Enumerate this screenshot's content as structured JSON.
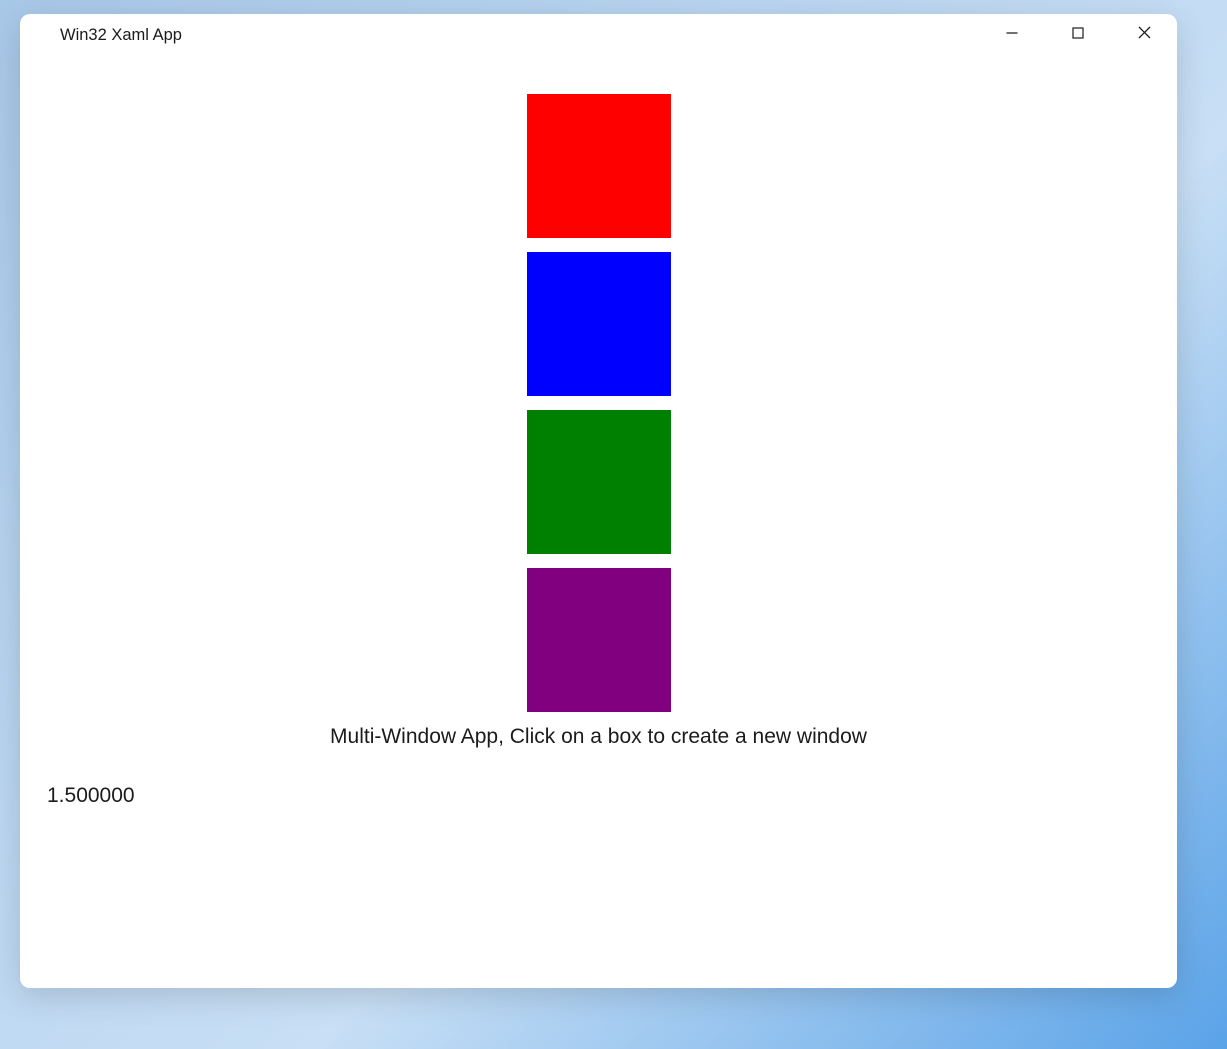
{
  "window": {
    "title": "Win32 Xaml App"
  },
  "boxes": [
    {
      "name": "red",
      "color": "#FF0000"
    },
    {
      "name": "blue",
      "color": "#0000FF"
    },
    {
      "name": "green",
      "color": "#008000"
    },
    {
      "name": "purple",
      "color": "#800080"
    }
  ],
  "instruction": "Multi-Window App, Click on a box to create a new window",
  "scale_value": "1.500000"
}
